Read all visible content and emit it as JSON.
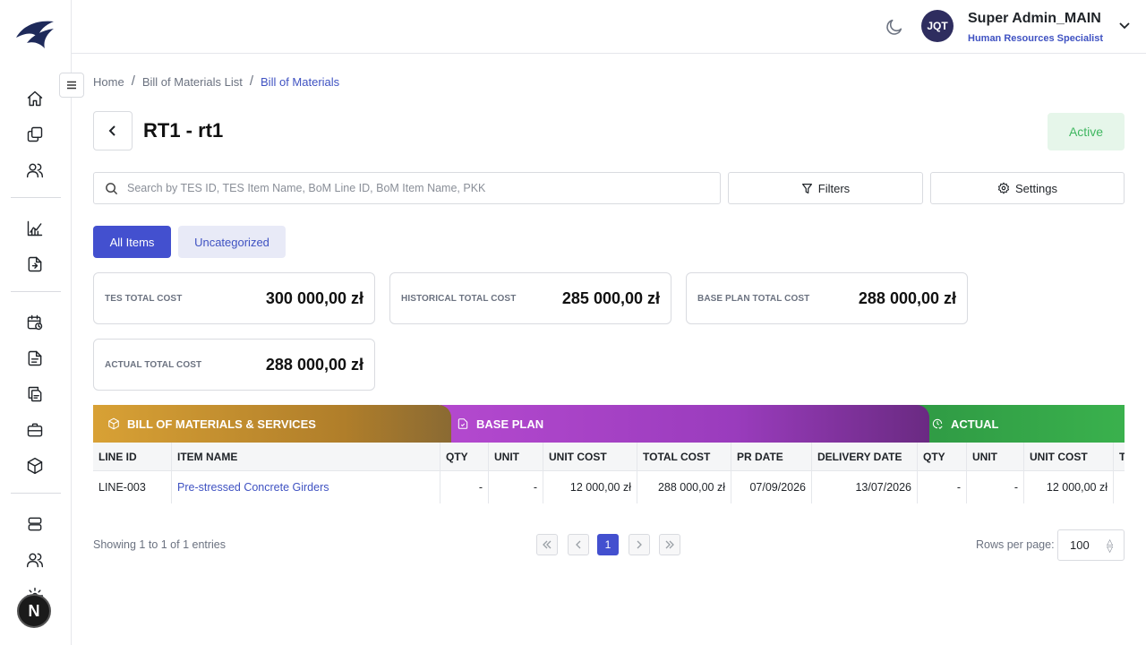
{
  "header": {
    "avatar_initials": "JQT",
    "user_name": "Super Admin_MAIN",
    "user_role": "Human Resources Specialist"
  },
  "breadcrumb": [
    "Home",
    "Bill of Materials List",
    "Bill of Materials"
  ],
  "page": {
    "title": "RT1 - rt1",
    "status": "Active"
  },
  "search": {
    "placeholder": "Search by TES ID, TES Item Name, BoM Line ID, BoM Item Name, PKK"
  },
  "toolbar": {
    "filters_label": "Filters",
    "settings_label": "Settings"
  },
  "tabs": [
    {
      "label": "All Items",
      "active": true
    },
    {
      "label": "Uncategorized",
      "active": false
    }
  ],
  "cards": [
    {
      "label": "TES TOTAL COST",
      "value": "300 000,00 zł"
    },
    {
      "label": "HISTORICAL TOTAL COST",
      "value": "285 000,00 zł"
    },
    {
      "label": "BASE PLAN TOTAL COST",
      "value": "288 000,00 zł"
    },
    {
      "label": "ACTUAL TOTAL COST",
      "value": "288 000,00 zł"
    }
  ],
  "table": {
    "groups": [
      {
        "label": "BILL OF MATERIALS & SERVICES",
        "icon": "box-icon",
        "color": "#d8a135"
      },
      {
        "label": "BASE PLAN",
        "icon": "file-check-icon",
        "color": "#b449cf"
      },
      {
        "label": "ACTUAL",
        "icon": "clock-check-icon",
        "color": "#3ab14d"
      }
    ],
    "columns": [
      "LINE ID",
      "ITEM NAME",
      "QTY",
      "UNIT",
      "UNIT COST",
      "TOTAL COST",
      "PR DATE",
      "DELIVERY DATE",
      "QTY",
      "UNIT",
      "UNIT COST",
      "T"
    ],
    "rows": [
      [
        "LINE-003",
        "Pre-stressed Concrete Girders",
        "-",
        "-",
        "12 000,00 zł",
        "288 000,00 zł",
        "07/09/2026",
        "13/07/2026",
        "-",
        "-",
        "12 000,00 zł",
        ""
      ]
    ]
  },
  "footer": {
    "showing": "Showing 1 to 1 of 1 entries",
    "current_page": "1",
    "rows_per_page_label": "Rows per page:",
    "rows_per_page": "100"
  },
  "colors": {
    "accent": "#4350cf",
    "link": "#3f52c2",
    "active_status_bg": "#e6f6ea",
    "active_status_text": "#3fb760"
  },
  "misc": {
    "floating_badge": "N"
  }
}
